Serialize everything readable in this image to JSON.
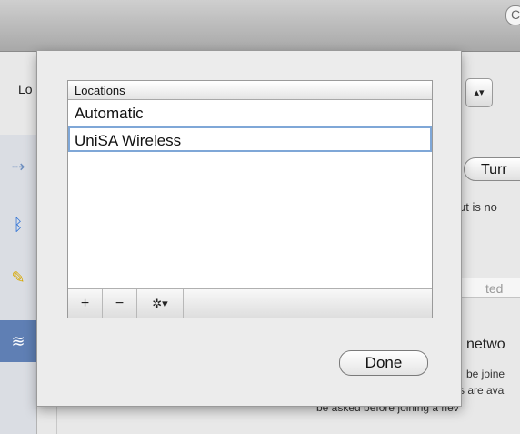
{
  "window": {
    "title_button_glyph": "C"
  },
  "location_label": "Lo",
  "location_stepper": "▴▾",
  "sidebar": {
    "items": [
      {
        "icon": "ethernet-icon",
        "glyph": "⇢"
      },
      {
        "icon": "bluetooth-icon",
        "glyph": "ᛒ"
      },
      {
        "icon": "pencil-icon",
        "glyph": "✎"
      },
      {
        "icon": "wifi-icon",
        "glyph": "≋"
      }
    ]
  },
  "background": {
    "turn_button": "Turr",
    "status_fragment": "ut is no",
    "network_field": "ted",
    "ask_checkbox": "✓",
    "ask_text": "netwo",
    "joined_text": "be joine",
    "available_text": "s are ava",
    "footer_text": "be asked before joining a nev"
  },
  "sheet": {
    "table_header": "Locations",
    "rows": [
      "Automatic",
      "UniSA Wireless"
    ],
    "toolbar": {
      "add": "+",
      "remove": "−",
      "gear": "✲▾"
    },
    "done_label": "Done"
  }
}
